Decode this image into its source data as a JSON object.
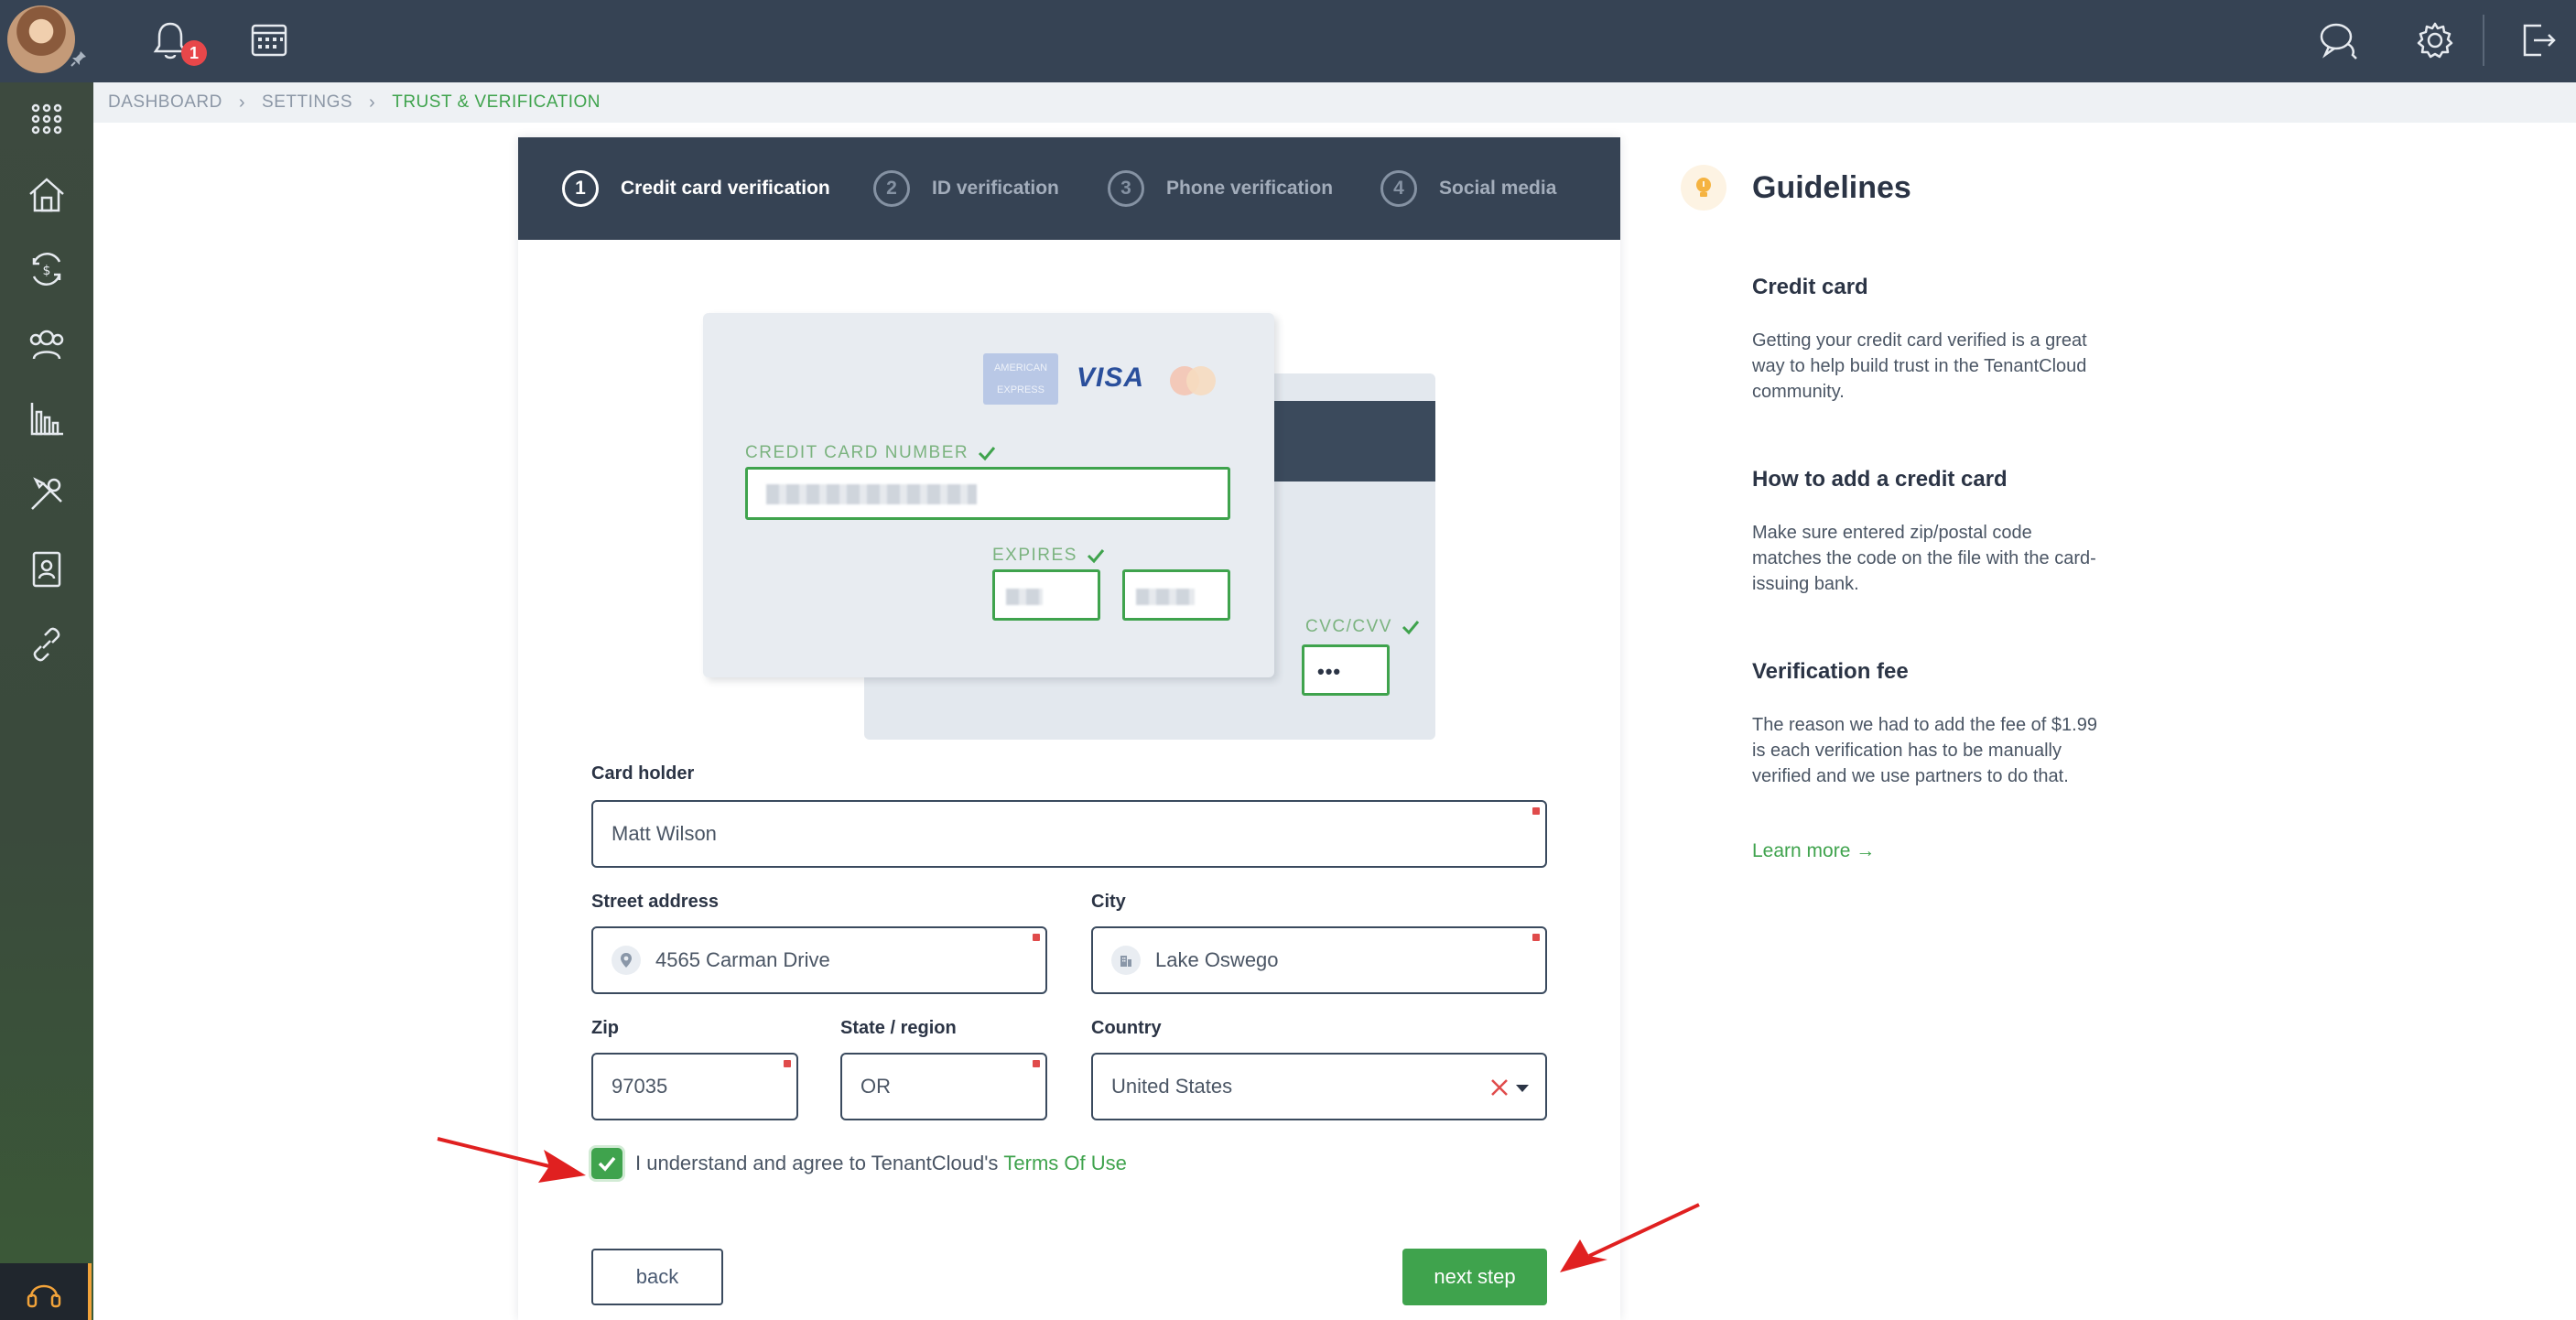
{
  "topbar": {
    "notification_count": "1"
  },
  "breadcrumb": {
    "items": [
      "DASHBOARD",
      "SETTINGS"
    ],
    "current": "TRUST & VERIFICATION"
  },
  "steps": [
    {
      "number": "1",
      "label": "Credit card verification",
      "active": true
    },
    {
      "number": "2",
      "label": "ID verification",
      "active": false
    },
    {
      "number": "3",
      "label": "Phone verification",
      "active": false
    },
    {
      "number": "4",
      "label": "Social media",
      "active": false
    }
  ],
  "card": {
    "number_label": "CREDIT CARD NUMBER",
    "expires_label": "EXPIRES",
    "cvc_label": "CVC/CVV",
    "cvc_value": "•••",
    "brand_visa": "VISA",
    "brand_amex": "AMERICAN EXPRESS"
  },
  "form": {
    "card_holder": {
      "label": "Card holder",
      "value": "Matt Wilson"
    },
    "street": {
      "label": "Street address",
      "value": "4565 Carman Drive"
    },
    "city": {
      "label": "City",
      "value": "Lake Oswego"
    },
    "zip": {
      "label": "Zip",
      "value": "97035"
    },
    "state": {
      "label": "State / region",
      "value": "OR"
    },
    "country": {
      "label": "Country",
      "value": "United States"
    },
    "agree_text": "I understand and agree to TenantCloud's",
    "terms_link": "Terms Of Use",
    "agree_checked": true,
    "back_label": "back",
    "next_label": "next step"
  },
  "guidelines": {
    "title": "Guidelines",
    "sections": [
      {
        "heading": "Credit card",
        "text": "Getting your credit card verified is a great way to help build trust in the TenantCloud community."
      },
      {
        "heading": "How to add a credit card",
        "text": "Make sure entered zip/postal code matches the code on the file with the card-issuing bank."
      },
      {
        "heading": "Verification fee",
        "text": "The reason we had to add the fee of $1.99 is each verification has to be manually verified and we use partners to do that."
      }
    ],
    "learn_more": "Learn more →"
  },
  "colors": {
    "topbar": "#364354",
    "accent_green": "#3fa34d",
    "required_red": "#e04b4b",
    "annotation_arrow": "#e02020"
  }
}
